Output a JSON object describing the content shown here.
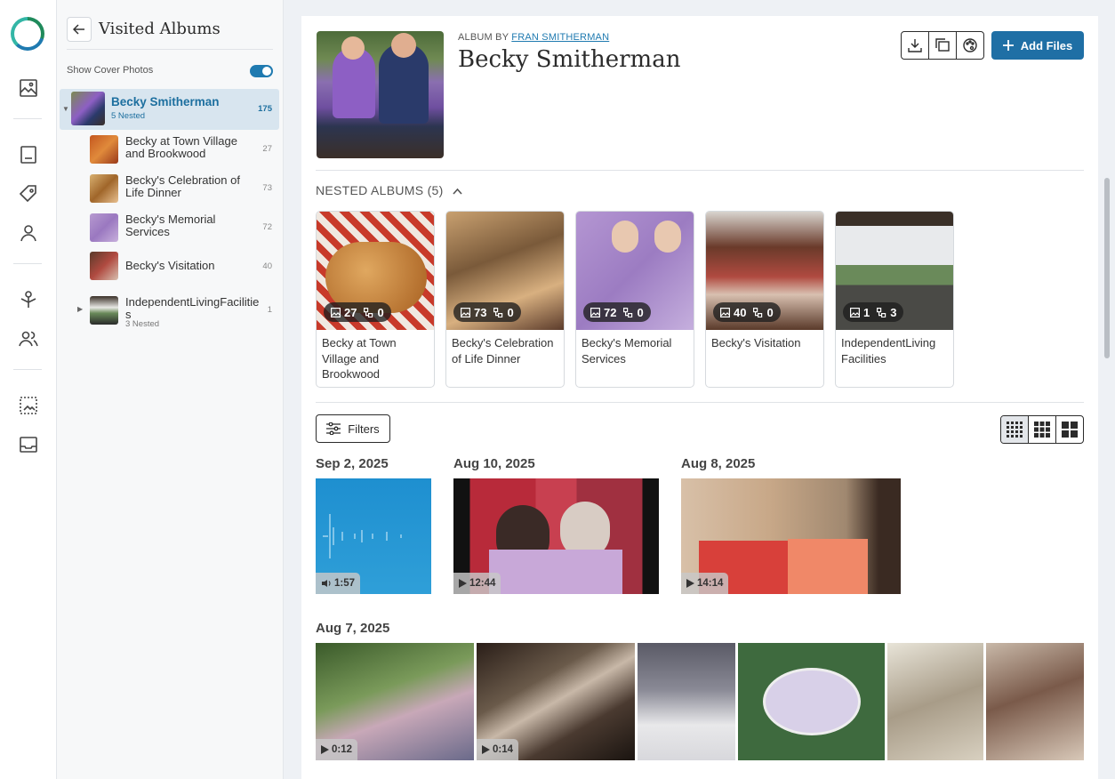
{
  "rail": {
    "icons": [
      "logo-icon",
      "photos-icon",
      "stories-icon",
      "tags-icon",
      "person-icon",
      "family-tree-icon",
      "people-icon",
      "scan-icon",
      "inbox-icon"
    ]
  },
  "sidebar": {
    "title": "Visited Albums",
    "show_cover_label": "Show Cover Photos",
    "show_cover_on": true,
    "albums": [
      {
        "name": "Becky Smitherman",
        "sub": "5 Nested",
        "count": "175",
        "selected": true
      },
      {
        "name": "Becky at Town Village and Brookwood",
        "count": "27"
      },
      {
        "name": "Becky's Celebration of Life Dinner",
        "count": "73"
      },
      {
        "name": "Becky's Memorial Services",
        "count": "72"
      },
      {
        "name": "Becky's Visitation",
        "count": "40"
      },
      {
        "name": "IndependentLivingFacilities",
        "sub": "3 Nested",
        "count": "1"
      }
    ]
  },
  "header": {
    "album_by_label": "ALBUM BY",
    "author": "FRAN SMITHERMAN",
    "title": "Becky Smitherman",
    "add_files": "Add Files"
  },
  "nested": {
    "heading": "NESTED ALBUMS (5)",
    "cards": [
      {
        "name": "Becky at Town Village and Brookwood",
        "photos": "27",
        "nested": "0"
      },
      {
        "name": "Becky's Celebration of Life Dinner",
        "photos": "73",
        "nested": "0"
      },
      {
        "name": "Becky's Memorial Services",
        "photos": "72",
        "nested": "0"
      },
      {
        "name": "Becky's Visitation",
        "photos": "40",
        "nested": "0"
      },
      {
        "name": "IndependentLiving Facilities",
        "photos": "1",
        "nested": "3"
      }
    ]
  },
  "filters_label": "Filters",
  "groups": [
    {
      "date": "Sep 2, 2025",
      "items": [
        {
          "duration": "1:57",
          "kind": "audio"
        }
      ]
    },
    {
      "date": "Aug 10, 2025",
      "items": [
        {
          "duration": "12:44",
          "kind": "video"
        }
      ]
    },
    {
      "date": "Aug 8, 2025",
      "items": [
        {
          "duration": "14:14",
          "kind": "video"
        }
      ]
    },
    {
      "date": "Aug 7, 2025",
      "items": [
        {
          "duration": "0:12",
          "kind": "video"
        },
        {
          "duration": "0:14",
          "kind": "video"
        },
        {
          "duration": "",
          "kind": "photo"
        },
        {
          "duration": "",
          "kind": "photo"
        },
        {
          "duration": "",
          "kind": "photo"
        },
        {
          "duration": "",
          "kind": "photo"
        }
      ]
    }
  ],
  "colors": {
    "accent": "#1f6fa5",
    "selected_bg": "#d8e5ef"
  }
}
